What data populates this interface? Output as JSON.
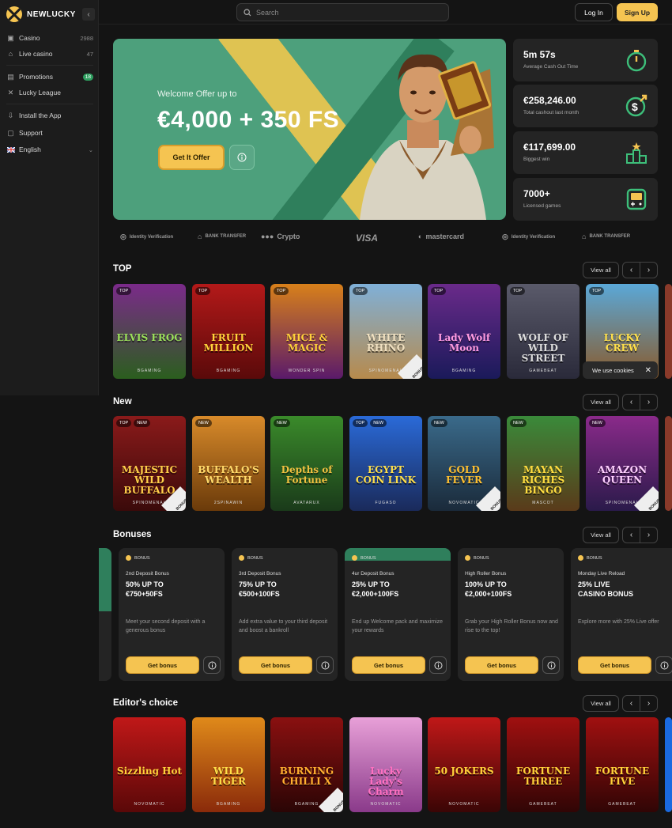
{
  "brand": {
    "name": "NEWLUCKY"
  },
  "sidebar": {
    "items": [
      {
        "label": "Casino",
        "count": "2988",
        "icon": "casino-icon"
      },
      {
        "label": "Live casino",
        "count": "47",
        "icon": "live-icon"
      },
      {
        "label": "Promotions",
        "count": "18",
        "icon": "gift-icon"
      },
      {
        "label": "Lucky League",
        "count": "",
        "icon": "swords-icon"
      },
      {
        "label": "Install the App",
        "count": "",
        "icon": "download-icon"
      },
      {
        "label": "Support",
        "count": "",
        "icon": "chat-icon"
      },
      {
        "label": "English",
        "count": "",
        "icon": "flag-uk-icon"
      }
    ]
  },
  "header": {
    "search_placeholder": "Search",
    "login": "Log In",
    "signup": "Sign Up"
  },
  "hero": {
    "subtitle": "Welcome Offer up to",
    "title": "€4,000 + 350 FS",
    "button": "Get It Offer"
  },
  "stats": [
    {
      "value": "5m 57s",
      "label": "Average Cash Out Time"
    },
    {
      "value": "€258,246.00",
      "label": "Total cashout last month"
    },
    {
      "value": "€117,699.00",
      "label": "Biggest win"
    },
    {
      "value": "7000+",
      "label": "Licensed games"
    }
  ],
  "payments": [
    "Identity Verification",
    "BANK TRANSFER",
    "Crypto",
    "VISA",
    "mastercard",
    "Identity Verification",
    "BANK TRANSFER"
  ],
  "sections": {
    "top": "TOP",
    "new": "New",
    "bonuses": "Bonuses",
    "editors": "Editor's choice",
    "view_all": "View all"
  },
  "top_games": [
    {
      "name": "ELVIS FROG",
      "provider": "BGAMING",
      "badges": [
        "TOP"
      ],
      "bonus_buy": false
    },
    {
      "name": "FRUIT MILLION",
      "provider": "BGAMING",
      "badges": [
        "TOP"
      ],
      "bonus_buy": false
    },
    {
      "name": "MICE & MAGIC",
      "provider": "WONDER SPIN",
      "badges": [
        "TOP"
      ],
      "bonus_buy": false
    },
    {
      "name": "WHITE RHINO",
      "provider": "SPINOMENAL",
      "badges": [
        "TOP"
      ],
      "bonus_buy": true
    },
    {
      "name": "Lady Wolf Moon",
      "provider": "BGAMING",
      "badges": [
        "TOP"
      ],
      "bonus_buy": false
    },
    {
      "name": "WOLF OF WILD STREET",
      "provider": "GAMEBEAT",
      "badges": [
        "TOP"
      ],
      "bonus_buy": false
    },
    {
      "name": "LUCKY CREW",
      "provider": "",
      "badges": [
        "TOP"
      ],
      "bonus_buy": false
    }
  ],
  "new_games": [
    {
      "name": "MAJESTIC WILD BUFFALO",
      "provider": "SPINOMENAL",
      "badges": [
        "TOP",
        "NEW"
      ],
      "bonus_buy": true
    },
    {
      "name": "BUFFALO'S WEALTH",
      "provider": "2SPINAWIN",
      "badges": [
        "NEW"
      ],
      "bonus_buy": false
    },
    {
      "name": "Depths of Fortune",
      "provider": "AVATARUX",
      "badges": [
        "NEW"
      ],
      "bonus_buy": false
    },
    {
      "name": "EGYPT COIN LINK",
      "provider": "FUGASO",
      "badges": [
        "TOP",
        "NEW"
      ],
      "bonus_buy": false
    },
    {
      "name": "GOLD FEVER",
      "provider": "NOVOMATIC",
      "badges": [
        "NEW"
      ],
      "bonus_buy": true
    },
    {
      "name": "MAYAN RICHES BINGO",
      "provider": "MASCOT",
      "badges": [
        "NEW"
      ],
      "bonus_buy": false
    },
    {
      "name": "AMAZON QUEEN",
      "provider": "SPINOMENAL",
      "badges": [
        "NEW"
      ],
      "bonus_buy": true
    }
  ],
  "bonuses": [
    {
      "tag": "BONUS",
      "title": "2nd Deposit Bonus",
      "headline1": "50% UP TO",
      "headline2": "€750+50FS",
      "desc": "Meet your second deposit with a generous bonus",
      "button": "Get bonus"
    },
    {
      "tag": "BONUS",
      "title": "3rd Deposit Bonus",
      "headline1": "75% UP TO",
      "headline2": "€500+100FS",
      "desc": "Add extra value to your third deposit and boost a bankroll",
      "button": "Get bonus"
    },
    {
      "tag": "BONUS",
      "title": "4ur Deposit Bonus",
      "headline1": "25% UP TO",
      "headline2": "€2,000+100FS",
      "desc": "End up Welcome pack and maximize your rewards",
      "button": "Get bonus"
    },
    {
      "tag": "BONUS",
      "title": "High Roller Bonus",
      "headline1": "100% UP TO",
      "headline2": "€2,000+100FS",
      "desc": "Grab your High Roller Bonus now and rise to the top!",
      "button": "Get bonus"
    },
    {
      "tag": "BONUS",
      "title": "Monday Live Reload",
      "headline1": "25% LIVE",
      "headline2": "CASINO BONUS",
      "desc": "Explore more with 25% Live offer",
      "button": "Get bonus"
    }
  ],
  "editors_games": [
    {
      "name": "Sizzling Hot",
      "provider": "NOVOMATIC",
      "badges": [],
      "bonus_buy": false
    },
    {
      "name": "WILD TIGER",
      "provider": "BGAMING",
      "badges": [],
      "bonus_buy": false
    },
    {
      "name": "BURNING CHILLI X",
      "provider": "BGAMING",
      "badges": [],
      "bonus_buy": true
    },
    {
      "name": "Lucky Lady's Charm",
      "provider": "NOVOMATIC",
      "badges": [],
      "bonus_buy": false
    },
    {
      "name": "50 JOKERS",
      "provider": "NOVOMATIC",
      "badges": [],
      "bonus_buy": false
    },
    {
      "name": "FORTUNE THREE",
      "provider": "GAMEBEAT",
      "badges": [],
      "bonus_buy": false
    },
    {
      "name": "FORTUNE FIVE",
      "provider": "GAMEBEAT",
      "badges": [],
      "bonus_buy": false
    }
  ],
  "cookie": {
    "text": "We use cookies"
  },
  "colors": {
    "accent": "#f5c451",
    "hero_bg": "#4da07c",
    "panel": "#242424",
    "bg": "#141414"
  }
}
